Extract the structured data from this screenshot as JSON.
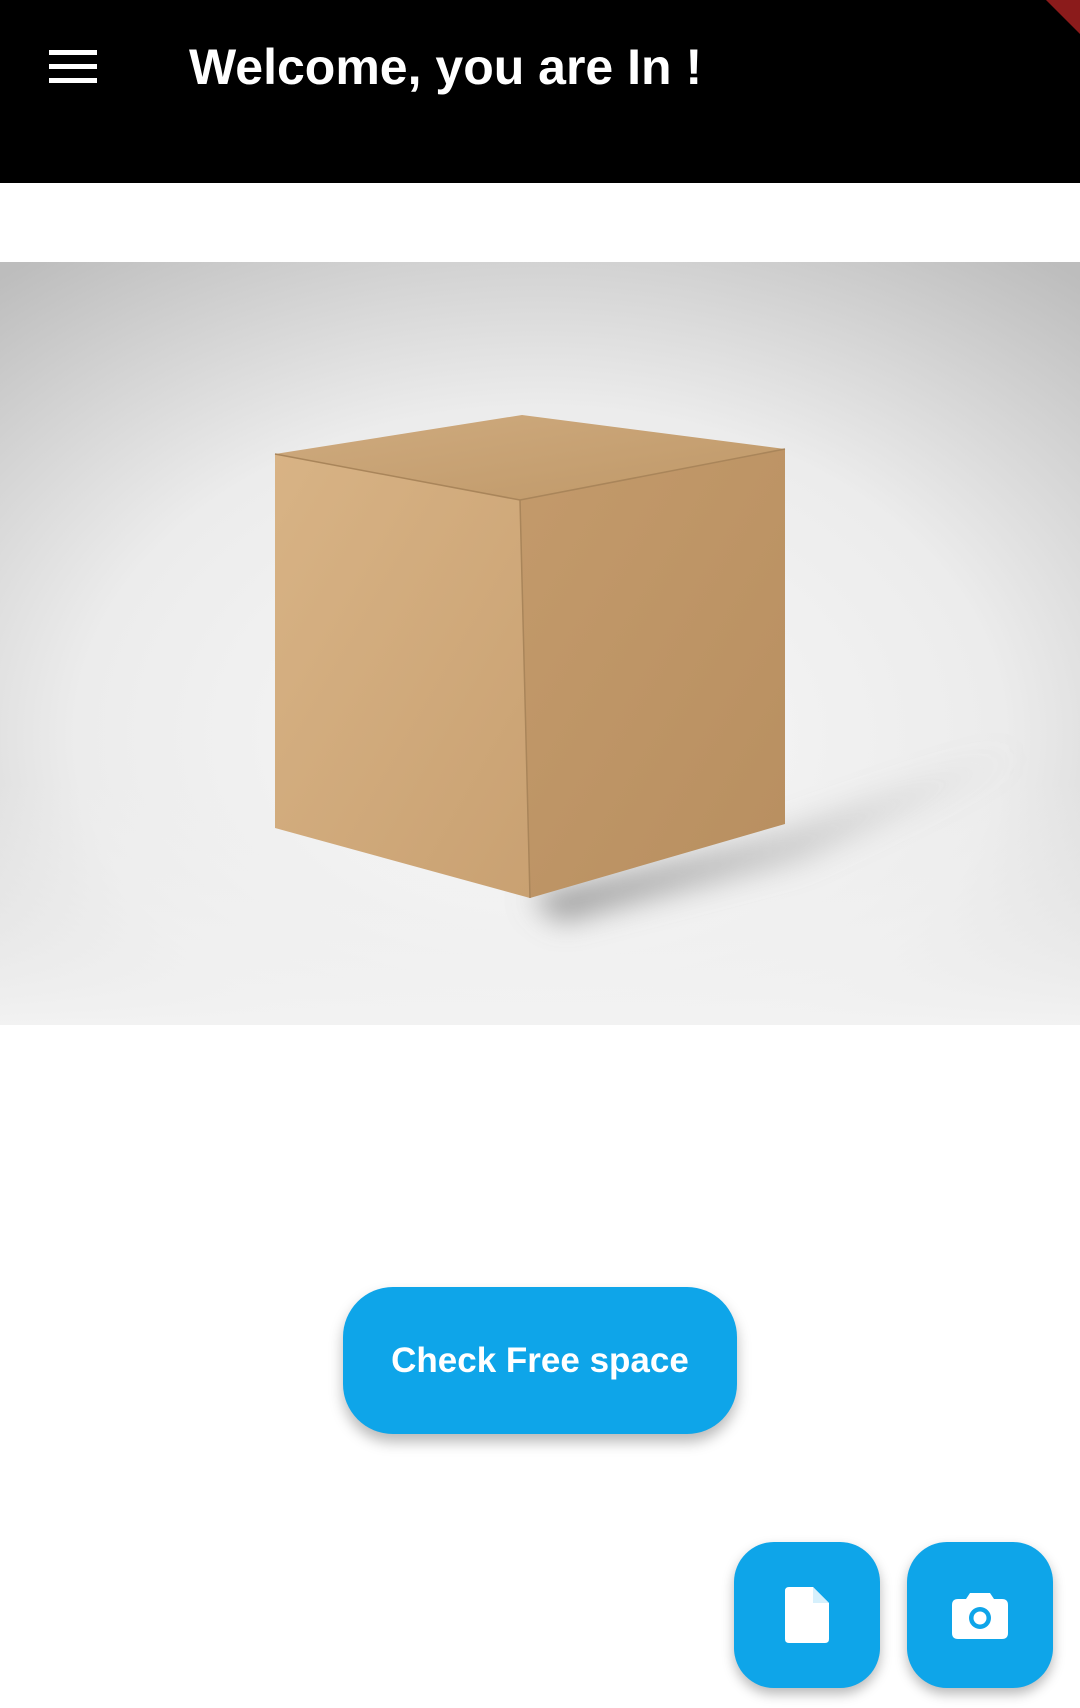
{
  "app_bar": {
    "title": "Welcome, you are In !",
    "menu_icon": "hamburger-menu-icon",
    "background_color": "#000000",
    "debug_ribbon_color": "#8b1b1b"
  },
  "hero": {
    "image_subject": "cardboard-box"
  },
  "actions": {
    "check_free_space_label": "Check Free space",
    "file_button_icon": "file-icon",
    "camera_button_icon": "camera-icon",
    "accent_color": "#0ea5e9"
  }
}
